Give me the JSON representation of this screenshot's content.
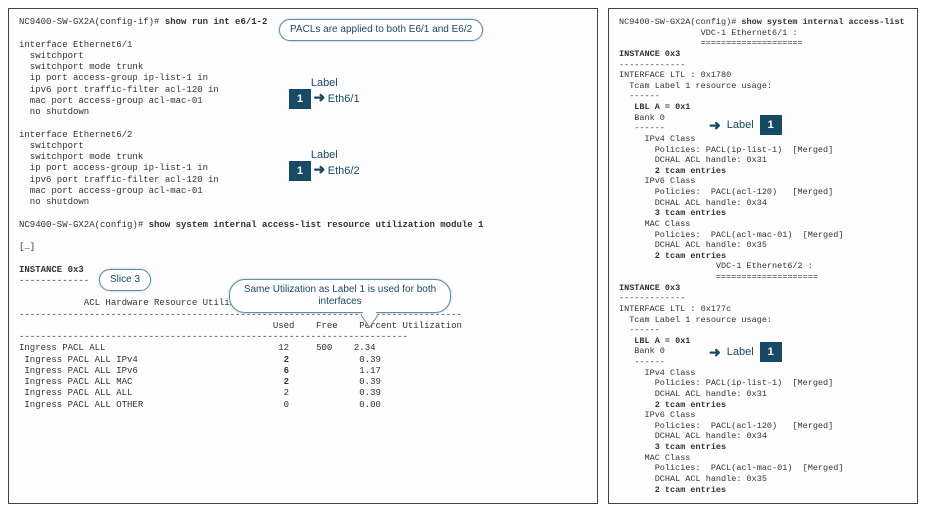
{
  "left": {
    "prompt1": "NC9400-SW-GX2A(config-if)# show run int e6/1-2",
    "prompt1_pre": "NC9400-SW-GX2A(config-if)# ",
    "prompt1_cmd": "show run int e6/1-2",
    "if1_header": "interface Ethernet6/1",
    "if1_lines": [
      "  switchport",
      "  switchport mode trunk",
      "  ip port access-group ip-list-1 in",
      "  ipv6 port traffic-filter acl-120 in",
      "  mac port access-group acl-mac-01",
      "  no shutdown"
    ],
    "if2_header": "interface Ethernet6/2",
    "if2_lines": [
      "  switchport",
      "  switchport mode trunk",
      "  ip port access-group ip-list-1 in",
      "  ipv6 port traffic-filter acl-120 in",
      "  mac port access-group acl-mac-01",
      "  no shutdown"
    ],
    "prompt2_pre": "NC9400-SW-GX2A(config)# ",
    "prompt2_cmd": "show system internal access-list resource utilization module 1",
    "ellipsis": "[…]",
    "instance": "INSTANCE 0x3",
    "instance_dashes": "-------------",
    "table_title": "            ACL Hardware Resource Utilization (Mod 1)",
    "table_hr": "----------------------------------------------------------------------------------",
    "table_header": "                                               Used    Free    Percent Utilization",
    "table_sep": "------------------------------------------------------------------------",
    "rows": [
      {
        "name": "Ingress PACL ALL",
        "used": "12",
        "free": "500",
        "pct": "2.34"
      },
      {
        "name": " Ingress PACL ALL IPv4",
        "used": "2",
        "free": "",
        "pct": "0.39"
      },
      {
        "name": " Ingress PACL ALL IPv6",
        "used": "6",
        "free": "",
        "pct": "1.17"
      },
      {
        "name": " Ingress PACL ALL MAC",
        "used": "2",
        "free": "",
        "pct": "0.39"
      },
      {
        "name": " Ingress PACL ALL ALL",
        "used": "2",
        "free": "",
        "pct": "0.39"
      },
      {
        "name": " Ingress PACL ALL OTHER",
        "used": "0",
        "free": "",
        "pct": "0.00"
      }
    ],
    "callouts": {
      "pacls": "PACLs are applied to\nboth E6/1 and E6/2",
      "slice": "Slice 3",
      "util": "Same Utilization as Label 1 is used\nfor both interfaces"
    },
    "labels": {
      "word": "Label",
      "num": "1",
      "arrow": "➜",
      "eth1": "Eth6/1",
      "eth2": "Eth6/2"
    }
  },
  "right": {
    "prompt_pre": "NC9400-SW-GX2A(config)# ",
    "prompt_cmd": "show system internal access-list",
    "vdc1_hdr": "                VDC-1 Ethernet6/1 :",
    "vdc1_sep": "                ====================",
    "instance": "INSTANCE 0x3",
    "instance_dashes": "-------------",
    "ltl": "INTERFACE LTL : 0x1780",
    "tcam_usage": "  Tcam Label 1 resource usage:",
    "tcam_dashes": "  ------",
    "lbl_a": "   LBL A = 0x1",
    "bank0": "   Bank 0",
    "bank_dashes": "   ------",
    "classes": [
      "     IPv4 Class",
      "       Policies: PACL(ip-list-1)  [Merged]",
      "       DCHAL ACL handle: 0x31",
      "       2 tcam entries",
      "     IPv6 Class",
      "       Policies:  PACL(acl-120)   [Merged]",
      "       DCHAL ACL handle: 0x34",
      "       3 tcam entries",
      "     MAC Class",
      "       Policies:  PACL(acl-mac-01)  [Merged]",
      "       DCHAL ACL handle: 0x35",
      "       2 tcam entries"
    ],
    "vdc2_hdr": "                   VDC-1 Ethernet6/2 :",
    "vdc2_sep": "                   ====================",
    "ltl2": "INTERFACE LTL : 0x177c",
    "labels": {
      "word": "Label",
      "num": "1",
      "arrow": "➜"
    }
  }
}
